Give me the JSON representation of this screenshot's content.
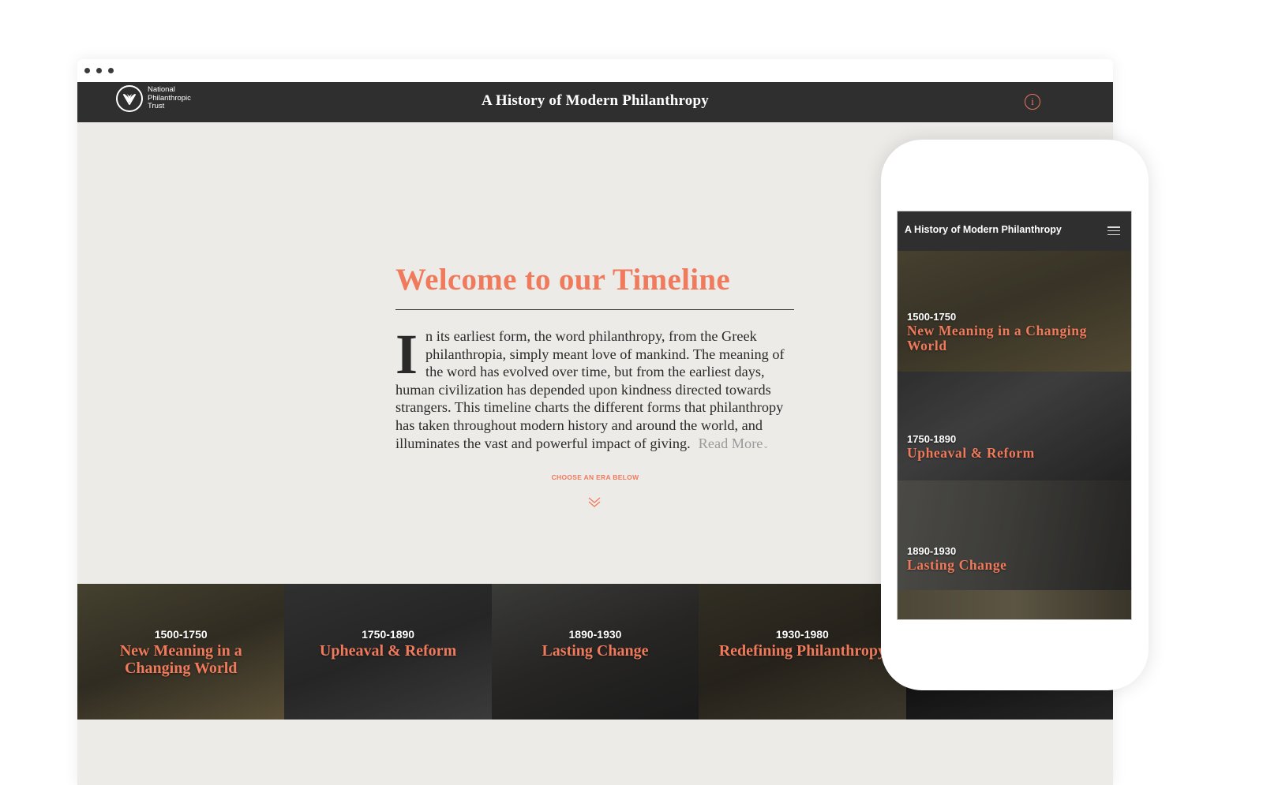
{
  "browser": {
    "dots": 3
  },
  "header": {
    "logo_lines": [
      "National",
      "Philanthropic",
      "Trust"
    ],
    "title": "A History of Modern Philanthropy",
    "info_icon": "info-icon",
    "info_glyph": "i"
  },
  "intro": {
    "heading": "Welcome to our Timeline",
    "drop_cap": "I",
    "body": "n its earliest form, the word philanthropy, from the Greek philanthropia, simply meant love of mankind.  The meaning of the word has evolved over time, but from the earliest days, human civilization has depended upon kindness directed towards strangers.  This timeline charts the different forms that philanthropy has taken throughout modern history and around the world, and illuminates the vast and powerful impact of giving.",
    "read_more": "Read More",
    "read_more_chevron": "⌄"
  },
  "choose": {
    "label": "CHOOSE AN ERA BELOW",
    "icon": "double-chevron-down-icon"
  },
  "eras": [
    {
      "years": "1500-1750",
      "title": "New Meaning in a Changing World",
      "bg": [
        "#6b6448",
        "#4a4434",
        "#8a7a55"
      ]
    },
    {
      "years": "1750-1890",
      "title": "Upheaval & Reform",
      "bg": [
        "#4a4a4a",
        "#3a3a3a",
        "#5a5a5a"
      ]
    },
    {
      "years": "1890-1930",
      "title": "Lasting Change",
      "bg": [
        "#5a5a56",
        "#3b3a38",
        "#2a2a2a"
      ]
    },
    {
      "years": "1930-1980",
      "title": "Redefining Philanthropy",
      "bg": [
        "#4d4738",
        "#3a352a",
        "#5c5543"
      ]
    },
    {
      "years": "",
      "title": "",
      "bg": [
        "#2a2a2a",
        "#1f1f1f",
        "#3a3a3a"
      ]
    }
  ],
  "phone": {
    "title": "A History of Modern Philanthropy",
    "menu_icon": "hamburger-menu-icon",
    "eras": [
      {
        "years": "1500-1750",
        "title": "New Meaning in a Changing World"
      },
      {
        "years": "1750-1890",
        "title": "Upheaval & Reform"
      },
      {
        "years": "1890-1930",
        "title": "Lasting Change"
      }
    ]
  },
  "colors": {
    "accent": "#ef7a5c",
    "header_bg": "#2f2f2f",
    "page_bg": "#edebe8",
    "text": "#2a2a2a"
  }
}
